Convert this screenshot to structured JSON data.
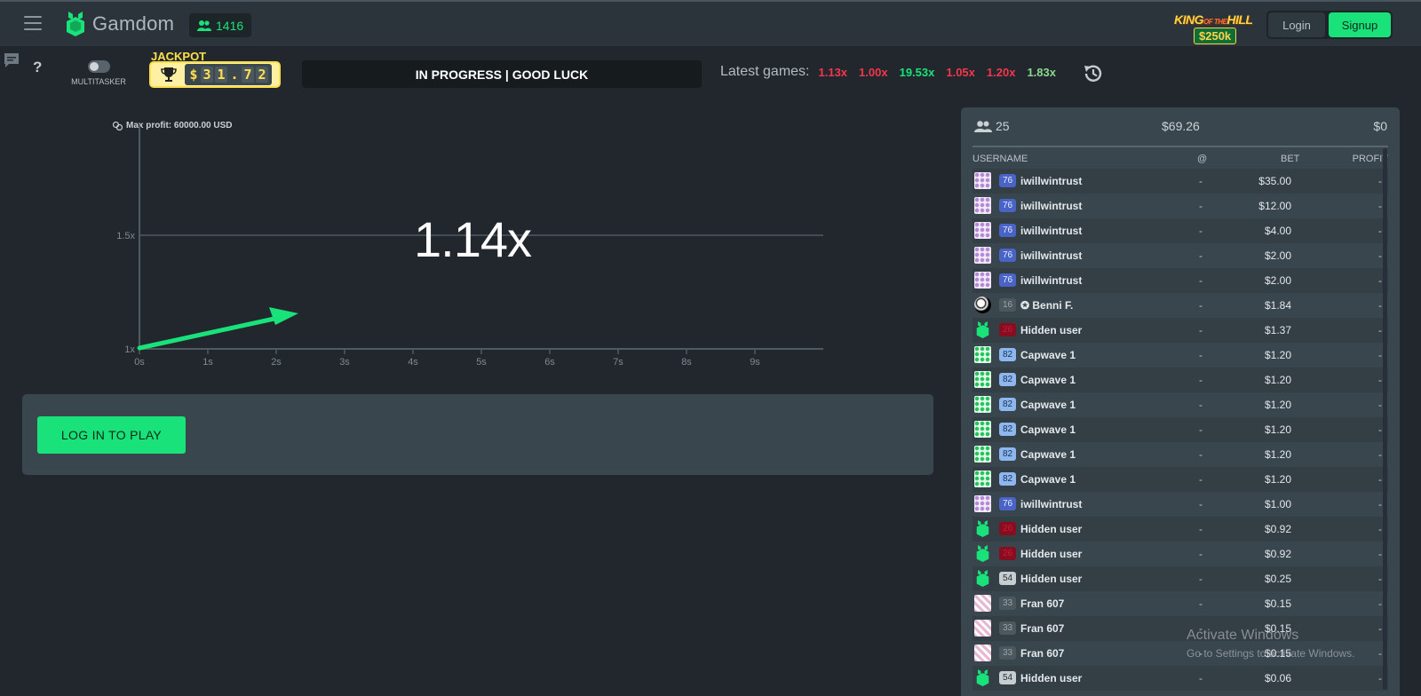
{
  "header": {
    "brand": "Gamdom",
    "online_count": "1416",
    "promo": {
      "top": "KING",
      "mid": "OF THE",
      "bottom": "HILL",
      "amount": "$250k"
    },
    "login_label": "Login",
    "signup_label": "Signup"
  },
  "toolbar": {
    "help_label": "?",
    "multitasker_label": "MULTITASKER",
    "jackpot_label": "JACKPOT",
    "jackpot_digits": [
      "$",
      "3",
      "1",
      ".",
      "7",
      "2"
    ],
    "status_text": "IN PROGRESS | GOOD LUCK",
    "latest_label": "Latest games:",
    "latest_games": [
      {
        "value": "1.13x",
        "color": "#f4364c"
      },
      {
        "value": "1.00x",
        "color": "#f4364c"
      },
      {
        "value": "19.53x",
        "color": "#19e27a"
      },
      {
        "value": "1.05x",
        "color": "#f4364c"
      },
      {
        "value": "1.20x",
        "color": "#f4364c"
      },
      {
        "value": "1.83x",
        "color": "#8bd98f"
      }
    ]
  },
  "graph": {
    "max_profit": "Max profit: 60000.00 USD",
    "multiplier": "1.14x",
    "y_ticks": [
      "1x",
      "1.5x"
    ],
    "x_ticks": [
      "0s",
      "1s",
      "2s",
      "3s",
      "4s",
      "5s",
      "6s",
      "7s",
      "8s",
      "9s"
    ],
    "line_color": "#19e27a"
  },
  "play": {
    "button_label": "LOG IN TO PLAY"
  },
  "bets": {
    "players": "25",
    "total_bet": "$69.26",
    "total_profit": "$0",
    "columns": {
      "username": "USERNAME",
      "at": "@",
      "bet": "BET",
      "profit": "PROFIT"
    },
    "rows": [
      {
        "avatar": "dots",
        "level": "76",
        "level_style": "blue",
        "name": "iwillwintrust",
        "at": "-",
        "bet": "$35.00",
        "profit": "-"
      },
      {
        "avatar": "dots",
        "level": "76",
        "level_style": "blue",
        "name": "iwillwintrust",
        "at": "-",
        "bet": "$12.00",
        "profit": "-"
      },
      {
        "avatar": "dots",
        "level": "76",
        "level_style": "blue",
        "name": "iwillwintrust",
        "at": "-",
        "bet": "$4.00",
        "profit": "-"
      },
      {
        "avatar": "dots",
        "level": "76",
        "level_style": "blue",
        "name": "iwillwintrust",
        "at": "-",
        "bet": "$2.00",
        "profit": "-"
      },
      {
        "avatar": "dots",
        "level": "76",
        "level_style": "blue",
        "name": "iwillwintrust",
        "at": "-",
        "bet": "$2.00",
        "profit": "-"
      },
      {
        "avatar": "bw",
        "level": "16",
        "level_style": "grey",
        "name": "✪ Benni F.",
        "at": "-",
        "bet": "$1.84",
        "profit": "-"
      },
      {
        "avatar": "gamdom",
        "level": "26",
        "level_style": "red",
        "name": "Hidden user",
        "at": "-",
        "bet": "$1.37",
        "profit": "-"
      },
      {
        "avatar": "green",
        "level": "82",
        "level_style": "light",
        "name": "Capwave 1",
        "at": "-",
        "bet": "$1.20",
        "profit": "-"
      },
      {
        "avatar": "green",
        "level": "82",
        "level_style": "light",
        "name": "Capwave 1",
        "at": "-",
        "bet": "$1.20",
        "profit": "-"
      },
      {
        "avatar": "green",
        "level": "82",
        "level_style": "light",
        "name": "Capwave 1",
        "at": "-",
        "bet": "$1.20",
        "profit": "-"
      },
      {
        "avatar": "green",
        "level": "82",
        "level_style": "light",
        "name": "Capwave 1",
        "at": "-",
        "bet": "$1.20",
        "profit": "-"
      },
      {
        "avatar": "green",
        "level": "82",
        "level_style": "light",
        "name": "Capwave 1",
        "at": "-",
        "bet": "$1.20",
        "profit": "-"
      },
      {
        "avatar": "green",
        "level": "82",
        "level_style": "light",
        "name": "Capwave 1",
        "at": "-",
        "bet": "$1.20",
        "profit": "-"
      },
      {
        "avatar": "dots",
        "level": "76",
        "level_style": "blue",
        "name": "iwillwintrust",
        "at": "-",
        "bet": "$1.00",
        "profit": "-"
      },
      {
        "avatar": "gamdom",
        "level": "26",
        "level_style": "red",
        "name": "Hidden user",
        "at": "-",
        "bet": "$0.92",
        "profit": "-"
      },
      {
        "avatar": "gamdom",
        "level": "26",
        "level_style": "red",
        "name": "Hidden user",
        "at": "-",
        "bet": "$0.92",
        "profit": "-"
      },
      {
        "avatar": "gamdom",
        "level": "54",
        "level_style": "white",
        "name": "Hidden user",
        "at": "-",
        "bet": "$0.25",
        "profit": "-"
      },
      {
        "avatar": "pink",
        "level": "33",
        "level_style": "grey",
        "name": "Fran 607",
        "at": "-",
        "bet": "$0.15",
        "profit": "-"
      },
      {
        "avatar": "pink",
        "level": "33",
        "level_style": "grey",
        "name": "Fran 607",
        "at": "-",
        "bet": "$0.15",
        "profit": "-"
      },
      {
        "avatar": "pink",
        "level": "33",
        "level_style": "grey",
        "name": "Fran 607",
        "at": "-",
        "bet": "$0.15",
        "profit": "-"
      },
      {
        "avatar": "gamdom",
        "level": "54",
        "level_style": "white",
        "name": "Hidden user",
        "at": "-",
        "bet": "$0.06",
        "profit": "-"
      }
    ]
  },
  "watermark": {
    "title": "Activate Windows",
    "subtitle": "Go to Settings to activate Windows."
  }
}
